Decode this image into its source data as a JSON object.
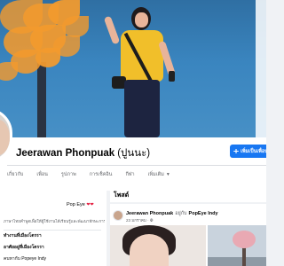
{
  "profile": {
    "name": "Jeerawan Phonpuak",
    "alt_name": "(ปูนนะ)",
    "add_friend_label": "เพิ่มเป็นเพื่อน"
  },
  "tabs": [
    {
      "label": "เกี่ยวกับ"
    },
    {
      "label": "เพื่อน"
    },
    {
      "label": "รูปภาพ"
    },
    {
      "label": "การเช็คอิน"
    },
    {
      "label": "กีฬา"
    },
    {
      "label": "เพิ่มเติม"
    }
  ],
  "intro": {
    "line1": "Pop Eye",
    "bio": "ภาษาไทยคำพูดเพื่อให้ผู้ใช้งานได้เรียนรู้และพัฒนาทักษะการสื่อสาร",
    "rows": [
      {
        "label": "ทำงานที่เมืองโตรรา"
      },
      {
        "label": "อาศัยอยู่ที่เมืองโตรรา"
      },
      {
        "label": "คบหากับ Popeye Indy"
      }
    ]
  },
  "posts": {
    "title": "โพสต์",
    "first": {
      "author": "Jeerawan Phonpuak",
      "verb": "อยู่กับ",
      "with": "PopEye Indy",
      "time": "23 มกราคม"
    }
  },
  "colors": {
    "accent": "#1877f2",
    "heart": "#e41e3f",
    "shirt": "#f1bf2a",
    "tree": "#f29a2e"
  },
  "icons": {
    "add_friend": "add-friend-icon",
    "heart": "heart-icon",
    "caret": "chevron-down-icon"
  }
}
